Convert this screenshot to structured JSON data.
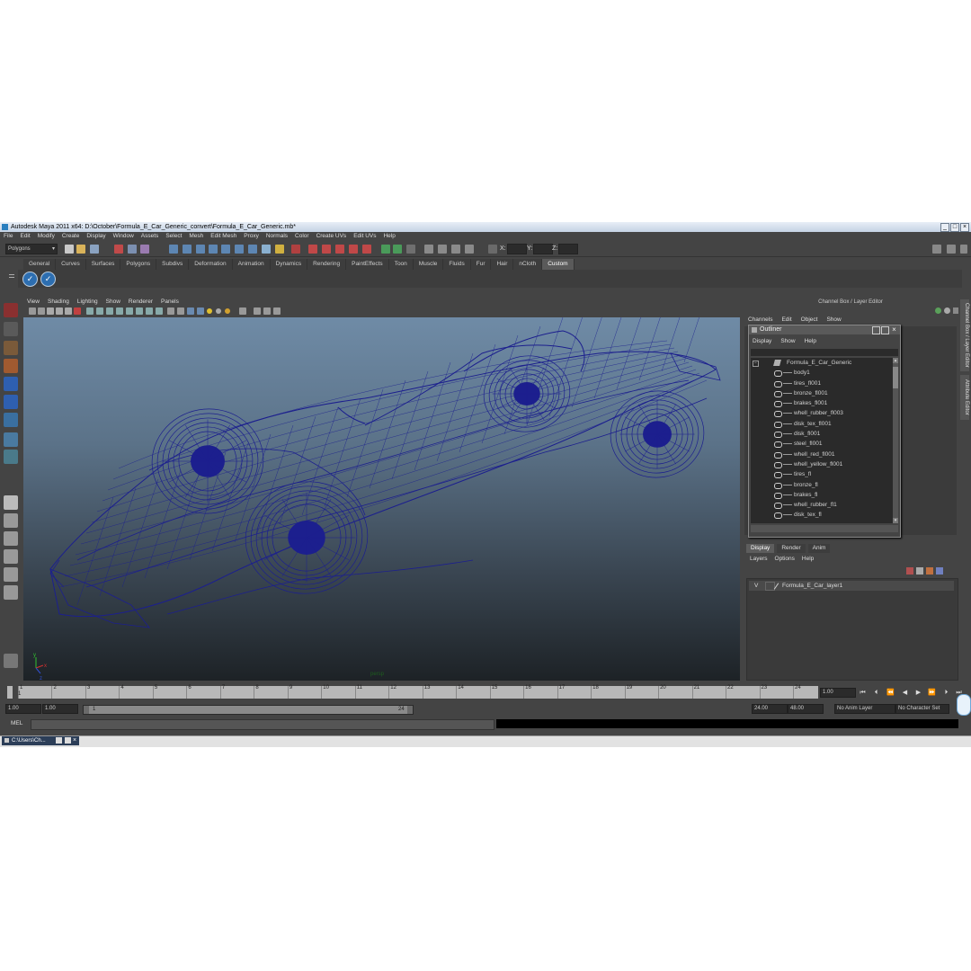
{
  "window": {
    "title": "Autodesk Maya 2011 x64: D:\\October\\Formula_E_Car_Generic_convert\\Formula_E_Car_Generic.mb*"
  },
  "menubar": [
    "File",
    "Edit",
    "Modify",
    "Create",
    "Display",
    "Window",
    "Assets",
    "Select",
    "Mesh",
    "Edit Mesh",
    "Proxy",
    "Normals",
    "Color",
    "Create UVs",
    "Edit UVs",
    "Help"
  ],
  "statusline": {
    "menu_set": "Polygons",
    "x_label": "X:",
    "y_label": "Y:",
    "z_label": "Z:"
  },
  "shelf": {
    "tabs": [
      "General",
      "Curves",
      "Surfaces",
      "Polygons",
      "Subdivs",
      "Deformation",
      "Animation",
      "Dynamics",
      "Rendering",
      "PaintEffects",
      "Toon",
      "Muscle",
      "Fluids",
      "Fur",
      "Hair",
      "nCloth",
      "Custom"
    ],
    "active_tab": "Custom"
  },
  "viewport": {
    "menu": [
      "View",
      "Shading",
      "Lighting",
      "Show",
      "Renderer",
      "Panels"
    ],
    "camera_label": "persp",
    "wire_color": "#1c1f8e",
    "axis_labels": {
      "y": "y",
      "x": "x",
      "z": "z"
    }
  },
  "channel_box": {
    "header": "Channel Box / Layer Editor",
    "menu": [
      "Channels",
      "Edit",
      "Object",
      "Show"
    ]
  },
  "side_tabs": [
    "Channel Box / Layer Editor",
    "Attribute Editor"
  ],
  "outliner": {
    "title": "Outliner",
    "menu": [
      "Display",
      "Show",
      "Help"
    ],
    "root": "Formula_E_Car_Generic",
    "items": [
      "body1",
      "tires_fl001",
      "bronze_fl001",
      "brakes_fl001",
      "whell_rubber_fl003",
      "disk_tex_fl001",
      "disk_fl001",
      "steel_fl001",
      "whell_red_fl001",
      "whell_yellow_fl001",
      "tires_fl",
      "bronze_fl",
      "brakes_fl",
      "whell_rubber_fl1",
      "disk_tex_fl"
    ]
  },
  "layer_editor": {
    "tabs": [
      "Display",
      "Render",
      "Anim"
    ],
    "active_tab": "Display",
    "menu": [
      "Layers",
      "Options",
      "Help"
    ],
    "layers": [
      {
        "visible": "V",
        "name": "Formula_E_Car_layer1"
      }
    ]
  },
  "timeline": {
    "ticks": [
      "1",
      "2",
      "3",
      "4",
      "5",
      "6",
      "7",
      "8",
      "9",
      "10",
      "11",
      "12",
      "13",
      "14",
      "15",
      "16",
      "17",
      "18",
      "19",
      "20",
      "21",
      "22",
      "23",
      "24"
    ],
    "current_frame": "1.00",
    "start_time": "1.00",
    "playback_start": "1.00",
    "range_start": "1",
    "range_end": "24",
    "playback_end": "24.00",
    "end_time": "48.00",
    "anim_layer": "No Anim Layer",
    "character_set": "No Character Set"
  },
  "command_line": {
    "label": "MEL"
  },
  "taskbar": {
    "item": "C:\\Users\\Ch..."
  }
}
